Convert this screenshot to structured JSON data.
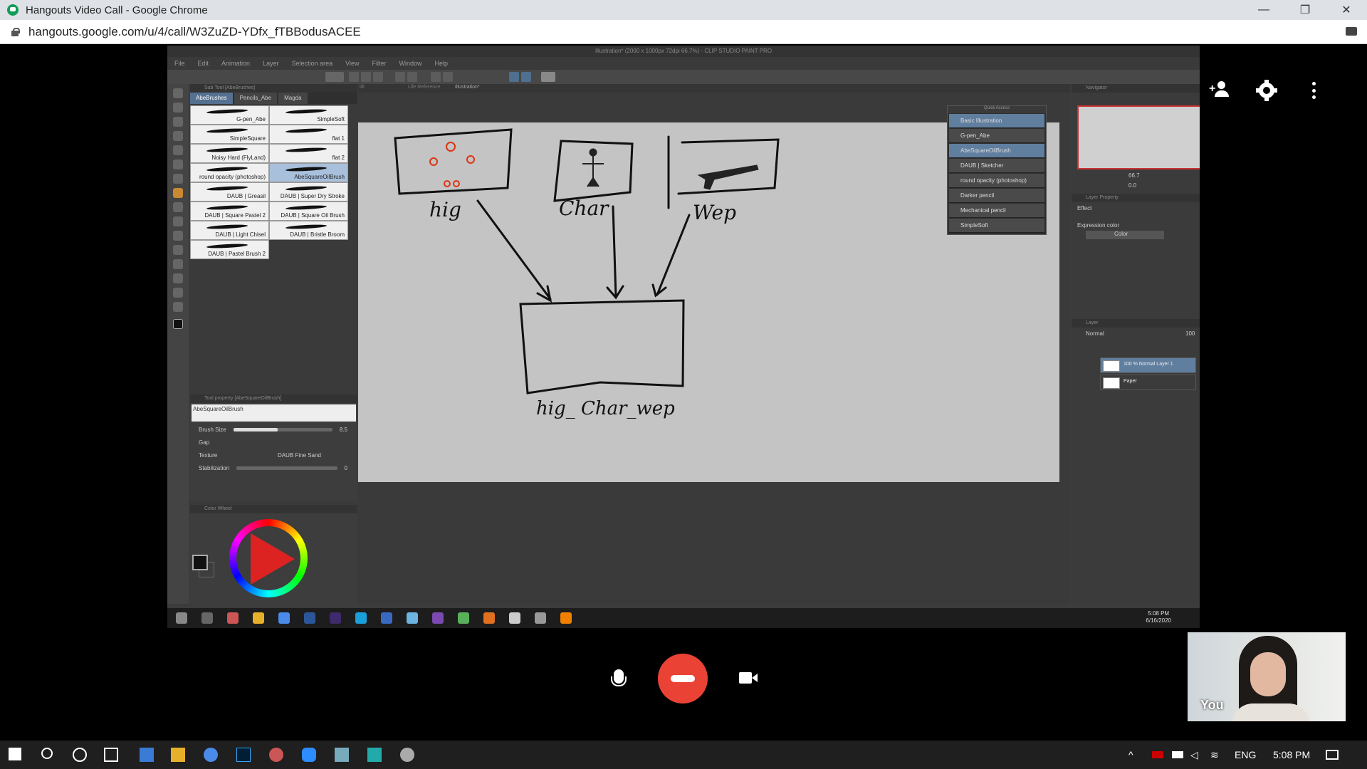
{
  "browser": {
    "window_title": "Hangouts Video Call - Google Chrome",
    "url": "hangouts.google.com/u/4/call/W3ZuZD-YDfx_fTBBodusACEE",
    "controls": {
      "minimize": "—",
      "maximize": "❐",
      "close": "✕"
    }
  },
  "csp": {
    "title": "Illustration* (2000 x 1000px 72dpi 66.7%) - CLIP STUDIO PAINT PRO",
    "menu": [
      "File",
      "Edit",
      "Animation",
      "Layer",
      "Selection area",
      "View",
      "Filter",
      "Window",
      "Help"
    ],
    "canvas_tabs": [
      "tilt",
      "Life Reference",
      "Illustration*"
    ],
    "subtool": {
      "header": "Sub Tool [AbeBrushes]",
      "tabs": [
        "AbeBrushes",
        "Pencils_Abe",
        "Magda"
      ],
      "brushes": [
        {
          "name": "G-pen_Abe",
          "sel": false
        },
        {
          "name": "SimpleSoft",
          "sel": false
        },
        {
          "name": "SimpleSquare",
          "sel": false
        },
        {
          "name": "flat 1",
          "sel": false
        },
        {
          "name": "Noisy Hard (FlyLand)",
          "sel": false
        },
        {
          "name": "flat 2",
          "sel": false
        },
        {
          "name": "round opacity (photoshop)",
          "sel": false
        },
        {
          "name": "AbeSquareOilBrush",
          "sel": true
        },
        {
          "name": "DAUB | Greasil",
          "sel": false
        },
        {
          "name": "DAUB | Super Dry Stroke",
          "sel": false
        },
        {
          "name": "DAUB | Square Pastel 2",
          "sel": false
        },
        {
          "name": "DAUB | Square Oil Brush",
          "sel": false
        },
        {
          "name": "DAUB | Light Chisel",
          "sel": false
        },
        {
          "name": "DAUB | Bristle Broom",
          "sel": false
        },
        {
          "name": "DAUB | Pastel Brush 2",
          "sel": false
        }
      ]
    },
    "toolprop": {
      "header": "Tool property [AbeSquareOilBrush]",
      "preview": "AbeSquareOilBrush",
      "brush_size_label": "Brush Size",
      "brush_size_value": "8.5",
      "brush_size_fraction": 0.45,
      "gap_label": "Gap",
      "texture_label": "Texture",
      "texture_value": "DAUB Fine Sand",
      "stabilization_label": "Stabilization",
      "stabilization_value": "0"
    },
    "colorwheel": {
      "header": "Color Wheel"
    },
    "quick_access": {
      "header": "Quick Access",
      "set": "Basic Illustration",
      "items": [
        "G-pen_Abe",
        "AbeSquareOilBrush",
        "DAUB | Sketcher",
        "round opacity (photoshop)",
        "Darker pencil",
        "Mechanical pencil",
        "SimpleSoft"
      ],
      "active_index": 1
    },
    "navigator": {
      "header": "Navigator",
      "zoom": "66.7",
      "angle": "0.0"
    },
    "layer_property": {
      "header": "Layer Property",
      "effect_label": "Effect",
      "expression_label": "Expression color",
      "expression_value": "Color"
    },
    "layers": {
      "header": "Layer",
      "blend": "Normal",
      "opacity": "100",
      "items": [
        {
          "name": "100 % Normal\nLayer 1",
          "active": true
        },
        {
          "name": "Paper",
          "active": false
        }
      ]
    },
    "sketch_labels": [
      "hig",
      "Char",
      "Wep",
      "hig_ Char_wep"
    ],
    "inner_clock": {
      "time": "5:08 PM",
      "date": "6/16/2020"
    }
  },
  "hangouts": {
    "self_label": "You",
    "icons": [
      "person-add-icon",
      "gear-icon",
      "more-vert-icon",
      "mic-icon",
      "hangup-icon",
      "camera-icon"
    ]
  },
  "taskbar": {
    "language": "ENG",
    "time": "5:08 PM"
  }
}
